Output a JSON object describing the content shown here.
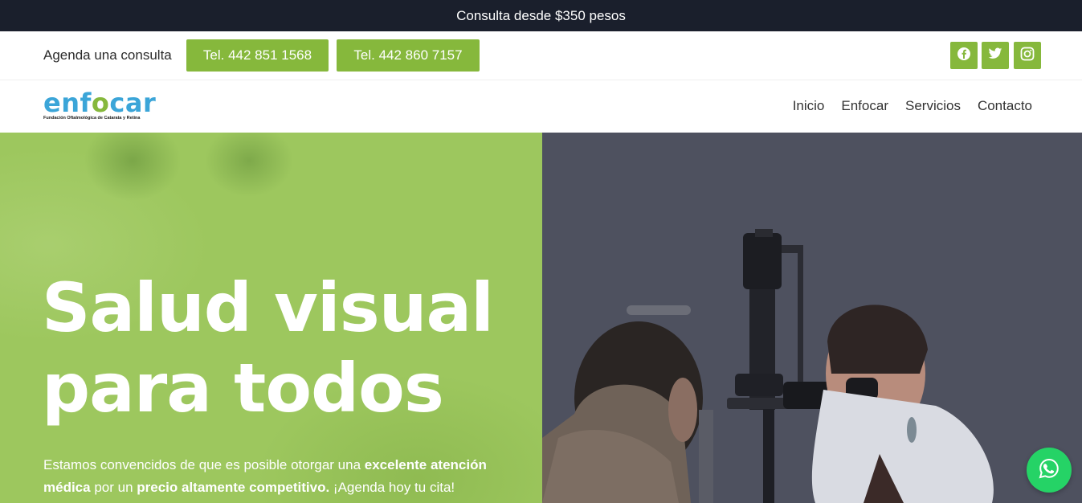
{
  "announcement": "Consulta desde $350 pesos",
  "contact_bar": {
    "agenda_label": "Agenda una consulta",
    "phone_buttons": [
      "Tel. 442 851 1568",
      "Tel. 442 860 7157"
    ],
    "social_icons": [
      "facebook-icon",
      "twitter-icon",
      "instagram-icon"
    ]
  },
  "brand": {
    "logo_part1": "enf",
    "logo_part2": "o",
    "logo_part3": "car",
    "tagline": "Fundación Oftalmológica de Catarata y Retina",
    "colors": {
      "blue": "#3ba5d8",
      "green": "#86b83c"
    }
  },
  "nav": {
    "items": [
      "Inicio",
      "Enfocar",
      "Servicios",
      "Contacto"
    ]
  },
  "hero": {
    "title_line1": "Salud visual",
    "title_line2": "para todos",
    "text_part1": "Estamos convencidos de que es posible otorgar una ",
    "text_bold1": "excelente atención médica",
    "text_part2": " por un ",
    "text_bold2": "precio altamente competitivo.",
    "text_part3": " ¡Agenda hoy tu cita!"
  },
  "floating": {
    "whatsapp_icon": "whatsapp-icon"
  },
  "colors": {
    "topbar": "#1a1f2c",
    "accent": "#86b83c",
    "hero_green": "#9dc75e",
    "whatsapp": "#25d366"
  }
}
